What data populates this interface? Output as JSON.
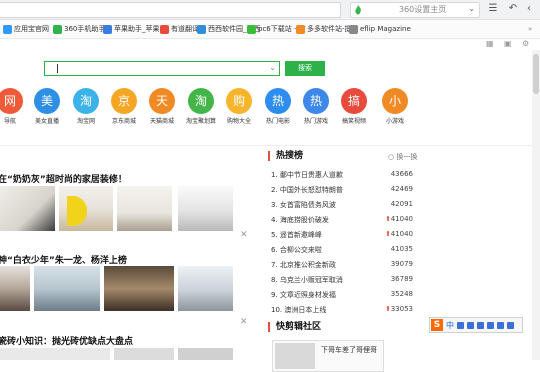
{
  "browser": {
    "site_box_text": "360设置主页",
    "colors": {
      "accent": "#2bb34a",
      "hot": "#e5513e"
    }
  },
  "bookmarks": [
    {
      "label": "应用宝官网",
      "color": "#2e9bff"
    },
    {
      "label": "360手机助手",
      "color": "#30b34a"
    },
    {
      "label": "苹果助手_苹果手",
      "color": "#3b7be0"
    },
    {
      "label": "有道翻译",
      "color": "#e84b3c"
    },
    {
      "label": "西西软件园_西西",
      "color": "#2f8fd8"
    },
    {
      "label": "pc6下载站 - 首",
      "color": "#3bbd3b"
    },
    {
      "label": "多多软件站-提供",
      "color": "#f08a24"
    },
    {
      "label": "eflip Magazine",
      "color": "#888888"
    }
  ],
  "search": {
    "button_label": "搜索"
  },
  "sites": [
    {
      "char": "网",
      "label": "导航",
      "color": "#ef5a3a"
    },
    {
      "char": "美",
      "label": "美女直播",
      "color": "#2f8ee5"
    },
    {
      "char": "淘",
      "label": "淘宝网",
      "color": "#3cb3e8"
    },
    {
      "char": "京",
      "label": "京东商城",
      "color": "#f5a623"
    },
    {
      "char": "天",
      "label": "天猫商城",
      "color": "#f08a24"
    },
    {
      "char": "淘",
      "label": "淘宝聚划算",
      "color": "#44b649"
    },
    {
      "char": "购",
      "label": "购物大全",
      "color": "#f7b52c"
    },
    {
      "char": "热",
      "label": "热门电影",
      "color": "#2d8ef0"
    },
    {
      "char": "热",
      "label": "热门游戏",
      "color": "#3d88e8"
    },
    {
      "char": "搞",
      "label": "搞笑视频",
      "color": "#e84b3c"
    },
    {
      "char": "小",
      "label": "小游戏",
      "color": "#f08a24"
    }
  ],
  "news": [
    {
      "headline": "在“奶奶灰”超时尚的家居装修！"
    },
    {
      "headline": "神“白衣少年”朱一龙、杨洋上榜"
    },
    {
      "headline": "瓷砖小知识：抛光砖优缺点大盘点"
    }
  ],
  "hot": {
    "title": "热搜榜",
    "swap_label": "换一换",
    "items": [
      {
        "rank": "1.",
        "name": "鄱中节日贵惠人道歉",
        "value": "43666",
        "up": false
      },
      {
        "rank": "2.",
        "name": "中国外长怒怼特朗普",
        "value": "42469",
        "up": false
      },
      {
        "rank": "3.",
        "name": "女首富陷债务风波",
        "value": "42091",
        "up": false
      },
      {
        "rank": "4.",
        "name": "海底捞股价破发",
        "value": "41040",
        "up": true
      },
      {
        "rank": "5.",
        "name": "遥首新邀峰峰",
        "value": "41040",
        "up": true
      },
      {
        "rank": "6.",
        "name": "合柳公交来啦",
        "value": "41035",
        "up": false
      },
      {
        "rank": "7.",
        "name": "北京推公积金新政",
        "value": "39079",
        "up": false
      },
      {
        "rank": "8.",
        "name": "乌克兰小贩冠军取消",
        "value": "36789",
        "up": false
      },
      {
        "rank": "9.",
        "name": "文章近照身材发福",
        "value": "35248",
        "up": false
      },
      {
        "rank": "10.",
        "name": "澳洲日本上线",
        "value": "33053",
        "up": true
      }
    ]
  },
  "section2": {
    "title": "快剪辑社区",
    "card_text": "下哥车差了哥俚哥"
  },
  "ime": {
    "zh": "中"
  }
}
